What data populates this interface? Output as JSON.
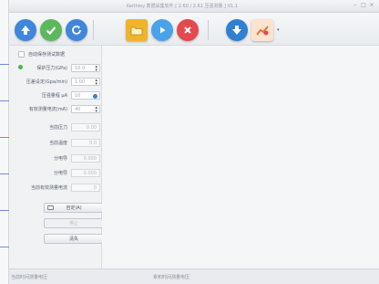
{
  "window": {
    "title": "Keithley 数据采集软件 [ 2.60 / 2.61 压强测量 ] V1.1"
  },
  "toolbar": {
    "buttons": [
      {
        "name": "upload",
        "color": "#3f86dc",
        "icon": "arrow-up-icon"
      },
      {
        "name": "confirm",
        "color": "#5cb85c",
        "icon": "check-icon"
      },
      {
        "name": "refresh",
        "color": "#3f86dc",
        "icon": "refresh-icon"
      },
      {
        "name": "open-folder",
        "color": "#f0b429",
        "icon": "folder-icon"
      },
      {
        "name": "play",
        "color": "#4aa3e8",
        "icon": "play-icon"
      },
      {
        "name": "stop",
        "color": "#e5484d",
        "icon": "stop-icon"
      },
      {
        "name": "download",
        "color": "#2f80d1",
        "icon": "arrow-down-icon"
      },
      {
        "name": "chart",
        "color": "#e8772e",
        "icon": "chart-icon"
      }
    ]
  },
  "panel": {
    "auto_save_label": "自动保存测试数据",
    "protect_pressure": {
      "label": "保护压力(GPa)",
      "value": "10.0"
    },
    "dwell_time": {
      "label": "压差设定(Gpa/min)",
      "value": "1.00"
    },
    "pressure_unit": {
      "label": "压强量程 μA",
      "value": "10"
    },
    "measure_current": {
      "label": "有效测量电流(mA)",
      "value": "40"
    },
    "current_pressure": {
      "label": "当前压力",
      "value": "0.00"
    },
    "current_temp": {
      "label": "当前温度",
      "value": "0.0"
    },
    "voltage": {
      "label": "分电导",
      "value": "0.000"
    },
    "resistance": {
      "label": "分电导",
      "value": "0.000"
    },
    "current_measure": {
      "label": "当前有效测量电流",
      "value": "0"
    },
    "buttons": {
      "start": "自定(A)",
      "stop": "停止",
      "clear": "清失"
    }
  },
  "status": {
    "left": "当前时间测量电压",
    "right": "累积时间测量电压"
  }
}
